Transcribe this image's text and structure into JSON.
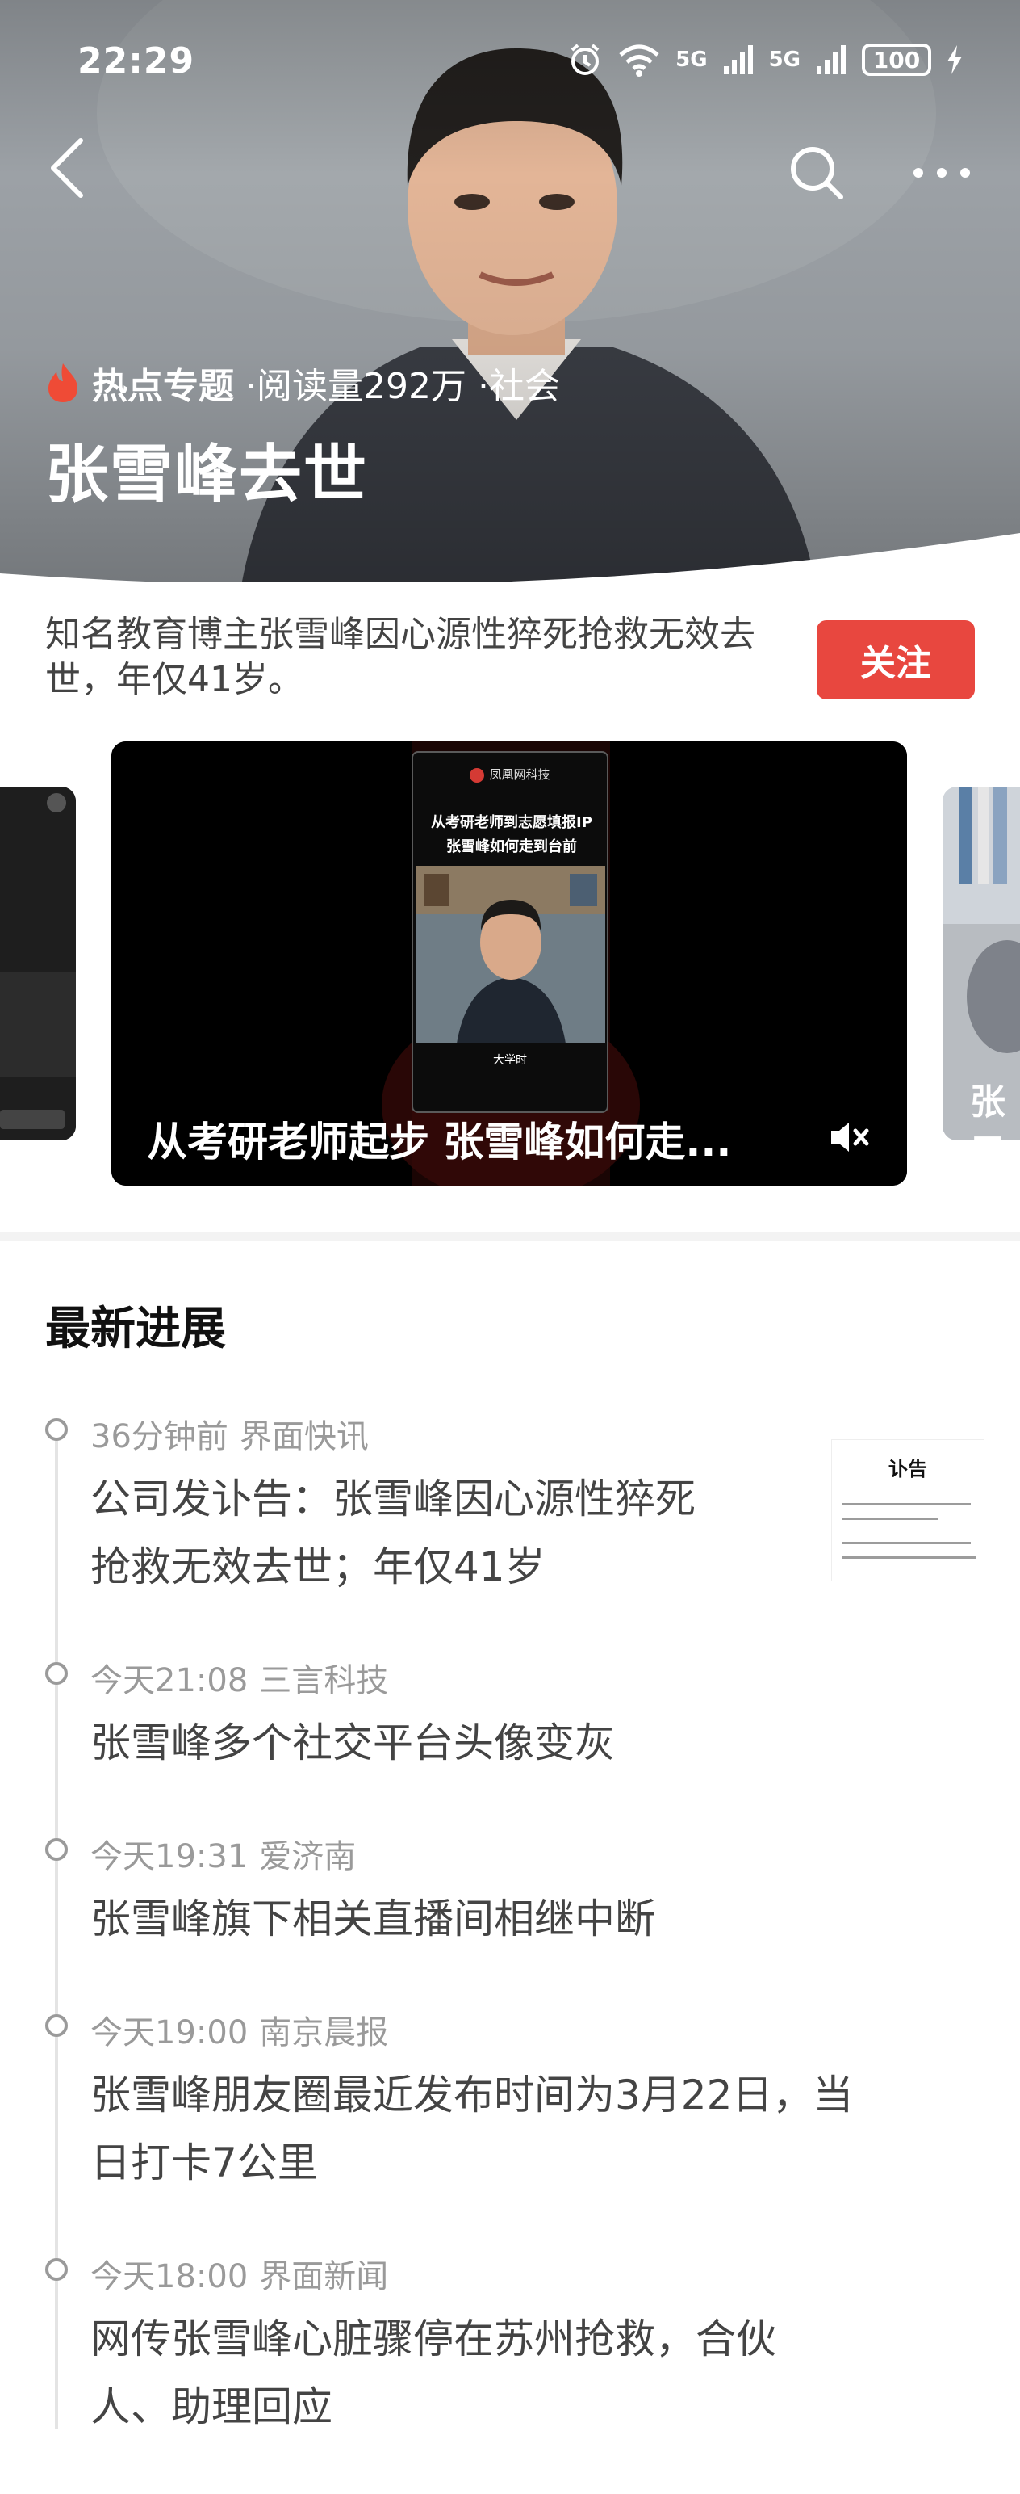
{
  "status_bar": {
    "time": "22:29",
    "network_1": "5G",
    "network_2": "5G",
    "battery": "100"
  },
  "hero": {
    "badge_icon": "flame-icon",
    "topic_label": "热点专题",
    "reads": "·阅读量292万",
    "category": "·社会",
    "title": "张雪峰去世"
  },
  "summary": {
    "text": "知名教育博主张雪峰因心源性猝死抢救无效去世，年仅41岁。",
    "follow_label": "关注"
  },
  "video": {
    "caption": "从考研老师起步 张雪峰如何走...",
    "frame_brand": "凤凰网科技",
    "frame_headline_1": "从考研老师到志愿填报IP",
    "frame_headline_2": "张雪峰如何走到台前",
    "frame_bottom": "大学时",
    "right_card_caption": "张雪"
  },
  "latest": {
    "title": "最新进展",
    "items": [
      {
        "time": "36分钟前",
        "source": "界面快讯",
        "headline": "公司发讣告：张雪峰因心源性猝死抢救无效去世；年仅41岁",
        "line_1": "公司发讣告：张雪峰因心源性猝死",
        "line_2": "抢救无效去世；年仅41岁",
        "thumb_title": "讣告"
      },
      {
        "time": "今天21:08",
        "source": "三言科技",
        "headline": "张雪峰多个社交平台头像变灰"
      },
      {
        "time": "今天19:31",
        "source": "爱济南",
        "headline": "张雪峰旗下相关直播间相继中断"
      },
      {
        "time": "今天19:00",
        "source": "南京晨报",
        "line_1": "张雪峰朋友圈最近发布时间为3月22日，当",
        "line_2": "日打卡7公里"
      },
      {
        "time": "今天18:00",
        "source": "界面新闻",
        "line_1": "网传张雪峰心脏骤停在苏州抢救，合伙",
        "line_2": "人、助理回应"
      }
    ]
  },
  "colors": {
    "accent_red": "#e8473f",
    "text_dark": "#111111",
    "text_mid": "#444444",
    "text_muted": "#9a9a9a"
  }
}
